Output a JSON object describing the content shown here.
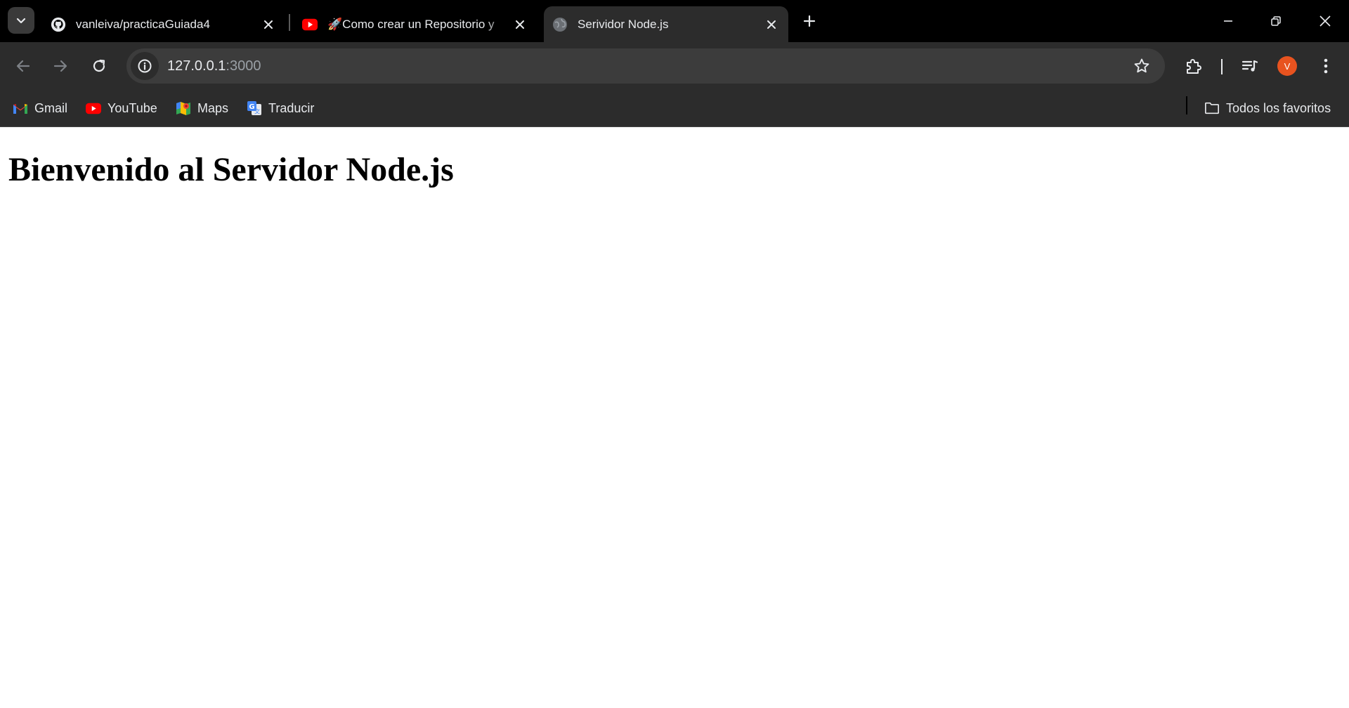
{
  "browser": {
    "tabs": [
      {
        "title": "vanleiva/practicaGuiada4",
        "favicon": "github-icon",
        "active": false
      },
      {
        "title": "🚀Como crear un Repositorio y",
        "favicon": "youtube-icon",
        "active": false
      },
      {
        "title": "Serividor Node.js",
        "favicon": "globe-icon",
        "active": true
      }
    ],
    "url_host": "127.0.0.1",
    "url_port": ":3000",
    "profile_initial": "V",
    "accent_color": "#e8531f"
  },
  "bookmarks": {
    "items": [
      {
        "label": "Gmail",
        "icon": "gmail-icon"
      },
      {
        "label": "YouTube",
        "icon": "youtube-icon"
      },
      {
        "label": "Maps",
        "icon": "maps-icon"
      },
      {
        "label": "Traducir",
        "icon": "translate-icon"
      }
    ],
    "all_bookmarks_label": "Todos los favoritos"
  },
  "page": {
    "heading": "Bienvenido al Servidor Node.js"
  }
}
